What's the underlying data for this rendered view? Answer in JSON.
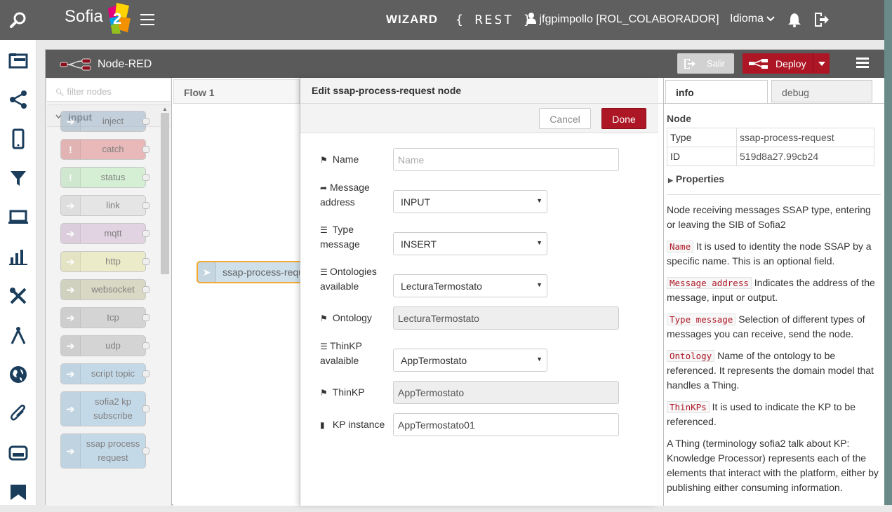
{
  "brand": {
    "name": "Sofia",
    "badge": "2"
  },
  "topbar": {
    "wizard": "WIZARD",
    "rest": "{ REST }",
    "user": "jfgpimpollo [ROL_COLABORADOR]",
    "language": "Idioma"
  },
  "nodered": {
    "title": "Node-RED",
    "salir": "Salir",
    "deploy": "Deploy"
  },
  "palette": {
    "filter_placeholder": "filter nodes",
    "category": "input",
    "nodes": [
      {
        "label": "inject",
        "color": "#a6bbcf"
      },
      {
        "label": "catch",
        "color": "#e49191"
      },
      {
        "label": "status",
        "color": "#c0edc0"
      },
      {
        "label": "link",
        "color": "#dddddd"
      },
      {
        "label": "mqtt",
        "color": "#d8bfd8"
      },
      {
        "label": "http",
        "color": "#e7e7ae"
      },
      {
        "label": "websocket",
        "color": "#c7c7a6"
      },
      {
        "label": "tcp",
        "color": "#c0c0c0"
      },
      {
        "label": "udp",
        "color": "#c0c0c0"
      },
      {
        "label": "script topic",
        "color": "#a6c9e2"
      },
      {
        "label": "sofia2 kp subscribe",
        "color": "#a6c9e2"
      },
      {
        "label": "ssap process request",
        "color": "#a6c9e2"
      }
    ]
  },
  "workspace": {
    "tab": "Flow 1",
    "node_label": "ssap-process-request"
  },
  "editor": {
    "title": "Edit ssap-process-request node",
    "cancel": "Cancel",
    "done": "Done",
    "fields": {
      "name_label": "Name",
      "name_placeholder": "Name",
      "address_label_1": "Message",
      "address_label_2": "address",
      "address_value": "INPUT",
      "type_label_1": "Type",
      "type_label_2": "message",
      "type_value": "INSERT",
      "ontologies_label_1": "Ontologies",
      "ontologies_label_2": "available",
      "ontologies_value": "LecturaTermostato",
      "ontology_label": "Ontology",
      "ontology_value": "LecturaTermostato",
      "thinkp_avail_label_1": "ThinKP",
      "thinkp_avail_label_2": "avalaible",
      "thinkp_avail_value": "AppTermostato",
      "thinkp_label": "ThinKP",
      "thinkp_value": "AppTermostato",
      "kp_instance_label": "KP instance",
      "kp_instance_value": "AppTermostato01"
    }
  },
  "sidebar": {
    "tab_info": "info",
    "tab_debug": "debug",
    "node_title": "Node",
    "type_key": "Type",
    "type_val": "ssap-process-request",
    "id_key": "ID",
    "id_val": "519d8a27.99cb24",
    "properties": "Properties",
    "help": {
      "intro": "Node receiving messages SSAP type, entering or leaving the SIB of Sofia2",
      "name_code": "Name",
      "name_text": " It is used to identity the node SSAP by a specific name. This is an optional field.",
      "address_code": "Message address",
      "address_text": " Indicates the address of the message, input or output.",
      "type_code": "Type message",
      "type_text": " Selection of different types of messages you can receive, send the node.",
      "ontology_code": "Ontology",
      "ontology_text": " Name of the ontology to be referenced. It represents the domain model that handles a Thing.",
      "thinkps_code": "ThinKPs",
      "thinkps_text": " It is used to indicate the KP to be referenced.",
      "thing_text": "A Thing (terminology sofia2 talk about KP: Knowledge Processor) represents each of the elements that interact with the platform, either by publishing either consuming information."
    }
  }
}
